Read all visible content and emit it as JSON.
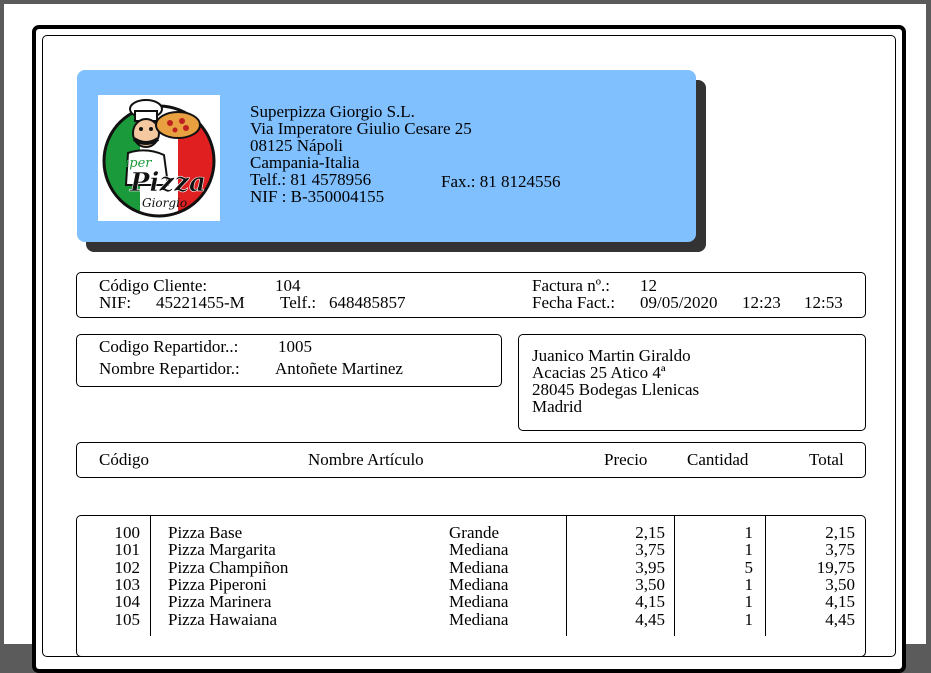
{
  "company": {
    "name": "Superpizza Giorgio S.L.",
    "address": "Via Imperatore Giulio Cesare 25",
    "postal": "08125 Nápoli",
    "region": "Campania-Italia",
    "phone": "Telf.:  81 4578956",
    "fax": "Fax.:  81 8124556",
    "nif": "NIF :  B-350004155",
    "logo_text_1": "Super",
    "logo_text_2": "Pizza",
    "logo_text_3": "Giorgio"
  },
  "client": {
    "code_label": "Código Cliente:",
    "code_value": "104",
    "nif_label": "NIF:",
    "nif_value": "45221455-M",
    "phone_label": "Telf.:",
    "phone_value": "648485857",
    "invoice_label": "Factura nº.:",
    "invoice_value": "12",
    "date_label": "Fecha Fact.:",
    "date_value": "09/05/2020",
    "time_1": "12:23",
    "time_2": "12:53"
  },
  "delivery": {
    "code_label": "Codigo Repartidor..:",
    "code_value": "1005",
    "name_label": "Nombre Repartidor.:",
    "name_value": "Antoñete Martinez"
  },
  "shipping": {
    "line1": "Juanico Martin Giraldo",
    "line2": "Acacias 25 Atico 4ª",
    "line3": "28045 Bodegas Llenicas",
    "line4": "Madrid"
  },
  "columns": {
    "code": "Código",
    "name": "Nombre Artículo",
    "price": "Precio",
    "qty": "Cantidad",
    "total": "Total"
  },
  "items": [
    {
      "code": "100",
      "name": "Pizza Base",
      "size": "Grande",
      "price": "2,15",
      "qty": "1",
      "total": "2,15"
    },
    {
      "code": "101",
      "name": "Pizza Margarita",
      "size": "Mediana",
      "price": "3,75",
      "qty": "1",
      "total": "3,75"
    },
    {
      "code": "102",
      "name": "Pizza Champiñon",
      "size": "Mediana",
      "price": "3,95",
      "qty": "5",
      "total": "19,75"
    },
    {
      "code": "103",
      "name": "Pizza Piperoni",
      "size": "Mediana",
      "price": "3,50",
      "qty": "1",
      "total": "3,50"
    },
    {
      "code": "104",
      "name": "Pizza Marinera",
      "size": "Mediana",
      "price": "4,15",
      "qty": "1",
      "total": "4,15"
    },
    {
      "code": "105",
      "name": "Pizza Hawaiana",
      "size": "Mediana",
      "price": "4,45",
      "qty": "1",
      "total": "4,45"
    }
  ]
}
